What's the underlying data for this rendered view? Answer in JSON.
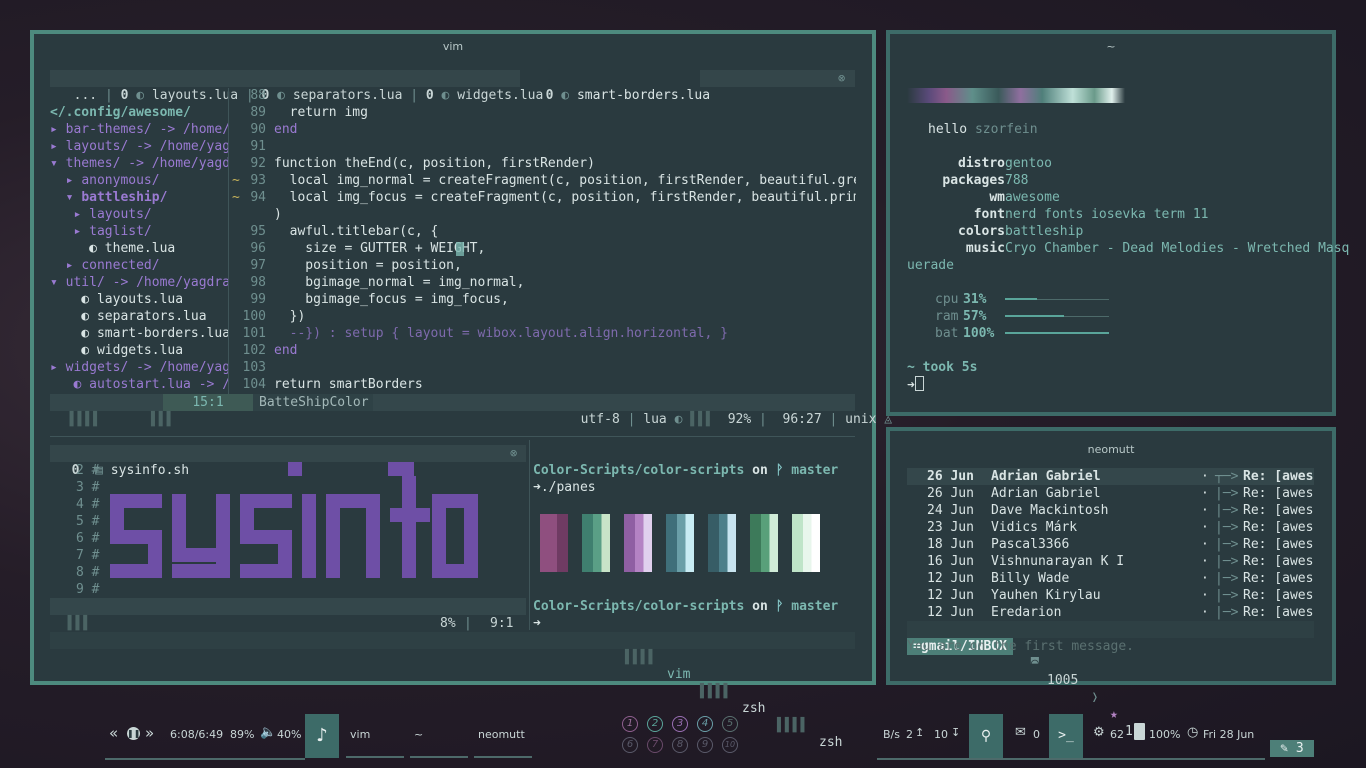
{
  "vim_window": {
    "title": "vim",
    "tabs": [
      "...",
      "0",
      "layouts.lua",
      "0",
      "separators.lua",
      "0",
      "widgets.lua",
      "0",
      "smart-borders.lua"
    ],
    "tree": {
      "root": "</.config/awesome/",
      "items": [
        "bar-themes/ -> /home/ya",
        "layouts/ -> /home/yagdr",
        "themes/ -> /home/yagdra",
        "anonymous/",
        "battleship/",
        "layouts/",
        "taglist/",
        "theme.lua",
        "connected/",
        "util/ -> /home/yagdra/l",
        "layouts.lua",
        "separators.lua",
        "smart-borders.lua",
        "widgets.lua",
        "widgets/ -> /home/yagdr",
        "autostart.lua -> /ho"
      ]
    },
    "code": {
      "line_numbers": [
        "88",
        "89",
        "90",
        "91",
        "92",
        "93",
        "94",
        "",
        "95",
        "96",
        "97",
        "98",
        "99",
        "100",
        "101",
        "102",
        "103",
        "104"
      ],
      "lines": [
        "",
        "  return img",
        "end",
        "",
        "function theEnd(c, position, firstRender)",
        "  local img_normal = createFragment(c, position, firstRender, beautiful.grey_light)",
        "  local img_focus = createFragment(c, position, firstRender, beautiful.primary_dark",
        ")",
        "  awful.titlebar(c, {",
        "    size = GUTTER + WEIGHT,",
        "    position = position,",
        "    bgimage_normal = img_normal,",
        "    bgimage_focus = img_focus,",
        "  })",
        "  --}) : setup { layout = wibox.layout.align.horizontal, }",
        "end",
        "",
        "return smartBorders"
      ]
    },
    "status_top": {
      "pos": "15:1",
      "name": "BatteShipColor",
      "encoding": "utf-8",
      "filetype": "lua",
      "percent": "92%",
      "cursor": "96:27",
      "format": "unix"
    },
    "sysinfo_tab": {
      "num": "0",
      "file": "sysinfo.sh"
    },
    "sysinfo_lines": [
      "2 #",
      "3 #",
      "4 #",
      "5 #",
      "6 #",
      "7 #",
      "8 #",
      "9 #"
    ],
    "status_bottom": {
      "percent": "8%",
      "cursor": "9:1"
    },
    "shell_prompt": {
      "path": "Color-Scripts/color-scripts",
      "on": "on",
      "branch": "master",
      "cmd": "./panes"
    },
    "tmux_tabs": [
      "vim",
      "zsh",
      "zsh"
    ]
  },
  "fetch_window": {
    "title": "~",
    "greeting": "hello",
    "user": "szorfein",
    "rows": [
      {
        "key": "distro",
        "val": "gentoo"
      },
      {
        "key": "packages",
        "val": "788"
      },
      {
        "key": "wm",
        "val": "awesome"
      },
      {
        "key": "font",
        "val": "nerd fonts iosevka term 11"
      },
      {
        "key": "colors",
        "val": "battleship"
      },
      {
        "key": "music",
        "val": "Cryo Chamber - Dead Melodies - Wretched Masq"
      }
    ],
    "music_wrap": "uerade",
    "meters": [
      {
        "key": "cpu",
        "val": "31%",
        "level": 0.31
      },
      {
        "key": "ram",
        "val": "57%",
        "level": 0.57
      },
      {
        "key": "bat",
        "val": "100%",
        "level": 1.0
      }
    ],
    "took": "~ took 5s"
  },
  "mutt_window": {
    "title": "neomutt",
    "mails": [
      {
        "date": "26 Jun",
        "from": "Adrian Gabriel",
        "subject": "Re: [awesom"
      },
      {
        "date": "26 Jun",
        "from": "Adrian Gabriel",
        "subject": "Re: [awesom"
      },
      {
        "date": "24 Jun",
        "from": "Dave Mackintosh",
        "subject": "Re: [awesom"
      },
      {
        "date": "23 Jun",
        "from": "Vidics Márk",
        "subject": "Re: [awesom"
      },
      {
        "date": "18 Jun",
        "from": "Pascal3366",
        "subject": "Re: [awesom"
      },
      {
        "date": "16 Jun",
        "from": "Vishnunarayan K I",
        "subject": "Re: [awesom"
      },
      {
        "date": "12 Jun",
        "from": "Billy Wade",
        "subject": "Re: [awesom"
      },
      {
        "date": "12 Jun",
        "from": "Yauhen Kirylau",
        "subject": "Re: [awesom"
      },
      {
        "date": "12 Jun",
        "from": "Eredarion",
        "subject": "Re: [awesom"
      }
    ],
    "mailbox": "=gmail/INBOX",
    "count": "1005",
    "flagged": "1",
    "new": "3",
    "message": "You are on the first message."
  },
  "wibar": {
    "player_time": "6:08/6:49",
    "player_pct": "89%",
    "volume": "40%",
    "tasks": [
      "vim",
      "~",
      "neomutt"
    ],
    "tags": [
      "1",
      "2",
      "3",
      "4",
      "5",
      "6",
      "7",
      "8",
      "9",
      "10"
    ],
    "net_label": "B/s",
    "net_up": "2",
    "net_down": "10",
    "mail_count": "0",
    "cpu_temp": "62",
    "battery": "100%",
    "date": "Fri 28 Jun"
  }
}
